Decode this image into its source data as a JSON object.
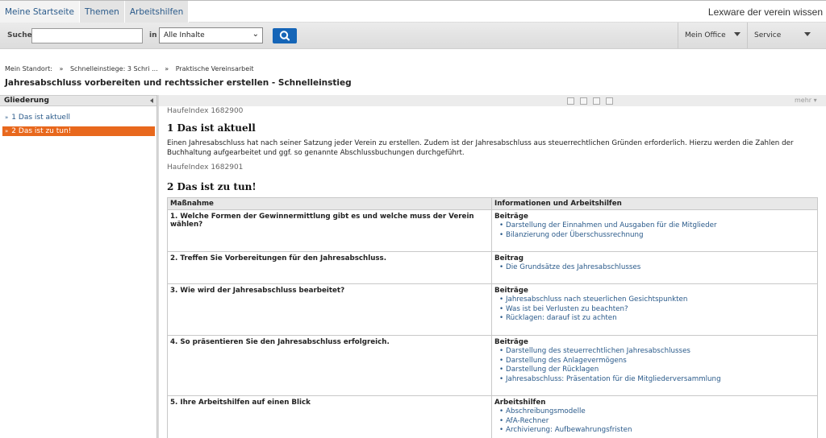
{
  "nav": {
    "tabs": [
      {
        "label": "Meine Startseite"
      },
      {
        "label": "Themen"
      },
      {
        "label": "Arbeitshilfen"
      }
    ],
    "brand": "Lexware der verein wissen"
  },
  "search": {
    "label": "Suche",
    "in_label": "in",
    "scope_value": "Alle Inhalte",
    "placeholder": ""
  },
  "header_menus": {
    "office": "Mein Office",
    "service": "Service"
  },
  "breadcrumb": {
    "root": "Mein Standort:",
    "items": [
      "Schnelleinstiege: 3 Schri ...",
      "Praktische Vereinsarbeit"
    ],
    "separator": "»"
  },
  "document": {
    "title": "Jahresabschluss vorbereiten und rechtssicher erstellen - Schnelleinstieg",
    "more_label": "mehr",
    "section1": {
      "index": "HaufeIndex 1682900",
      "heading": "1 Das ist aktuell",
      "text": "Einen Jahresabschluss hat nach seiner Satzung jeder Verein zu erstellen. Zudem ist der Jahresabschluss aus steuerrechtlichen Gründen erforderlich. Hierzu werden die Zahlen der Buchhaltung aufgearbeitet und ggf. so genannte Abschlussbuchungen durchgeführt."
    },
    "section2": {
      "index": "HaufeIndex 1682901",
      "heading": "2 Das ist zu tun!",
      "col1": "Maßnahme",
      "col2": "Informationen und Arbeitshilfen",
      "rows": [
        {
          "q": "1. Welche Formen der Gewinnermittlung gibt es und welche muss der Verein wählen?",
          "cat": "Beiträge",
          "links": [
            "Darstellung der Einnahmen und Ausgaben für die Mitglieder",
            "Bilanzierung oder Überschussrechnung"
          ]
        },
        {
          "q": "2. Treffen Sie Vorbereitungen für den Jahresabschluss.",
          "cat": "Beitrag",
          "links": [
            "Die Grundsätze des Jahresabschlusses"
          ]
        },
        {
          "q": "3. Wie wird der Jahresabschluss bearbeitet?",
          "cat": "Beiträge",
          "links": [
            "Jahresabschluss nach steuerlichen Gesichtspunkten",
            "Was ist bei Verlusten zu beachten?",
            "Rücklagen: darauf ist zu achten"
          ]
        },
        {
          "q": "4. So präsentieren Sie den Jahresabschluss erfolgreich.",
          "cat": "Beiträge",
          "links": [
            "Darstellung des steuerrechtlichen Jahresabschlusses",
            "Darstellung des Anlagevermögens",
            "Darstellung der Rücklagen",
            "Jahresabschluss: Präsentation für die Mitgliederversammlung"
          ]
        },
        {
          "q": "5. Ihre Arbeitshilfen auf einen Blick",
          "cat": "Arbeitshilfen",
          "links": [
            "Abschreibungsmodelle",
            "AfA-Rechner",
            "Archivierung: Aufbewahrungsfristen"
          ]
        }
      ]
    }
  },
  "toc": {
    "heading": "Gliederung",
    "items": [
      {
        "label": "1 Das ist aktuell"
      },
      {
        "label": "2 Das ist zu tun!"
      }
    ]
  },
  "colors": {
    "accent": "#e8681d",
    "link": "#2a5a8a",
    "button": "#1565b7"
  },
  "icons": [
    "search-icon",
    "print-icon",
    "pdf-icon",
    "save-icon",
    "mail-icon",
    "collapse-arrow-icon",
    "dropdown-caret-icon"
  ]
}
